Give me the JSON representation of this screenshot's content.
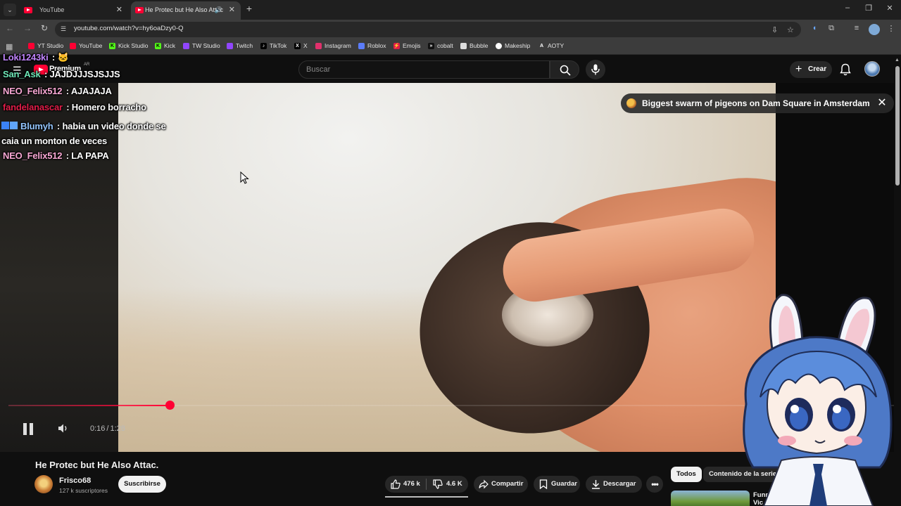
{
  "browser": {
    "tabs": [
      {
        "title": "YouTube",
        "active": false
      },
      {
        "title": "He Protec but He Also Attac",
        "active": true
      }
    ],
    "url": "youtube.com/watch?v=hy6oaDzy0-Q",
    "bookmarks": [
      "YT Studio",
      "YouTube",
      "Kick Studio",
      "Kick",
      "TW Studio",
      "Twitch",
      "TikTok",
      "X",
      "Instagram",
      "Roblox",
      "Emojis",
      "cobalt",
      "Bubble",
      "Makeship",
      "AOTY"
    ]
  },
  "youtube_header": {
    "logo_text": "Premium",
    "region": "AR",
    "search_placeholder": "Buscar",
    "create_label": "Crear"
  },
  "chat": [
    {
      "user": "Loki1243ki",
      "text": "🐱",
      "color": "#c084fc"
    },
    {
      "user": "San_Ask",
      "text": "JAJDJJJSJSJJS",
      "color": "#6ee7b7"
    },
    {
      "user": "NEO_Felix512",
      "text": "AJAJAJA",
      "color": "#f9a8d4"
    },
    {
      "user": "fandelanascar",
      "text": "Homero borracho",
      "color": "#e11d48"
    },
    {
      "user": "Blumyh",
      "text": "habia un video donde se caia un monton de veces",
      "color": "#93c5fd"
    },
    {
      "user": "NEO_Felix512",
      "text": "LA PAPA",
      "color": "#f9a8d4"
    }
  ],
  "notification_chip": "Biggest swarm of pigeons on Dam Square in Amsterdam",
  "player": {
    "current_time": "0:16",
    "duration": "1:28",
    "progress": 0.182,
    "accent_color": "#ff0033"
  },
  "video": {
    "title": "He Protec but He Also Attac.",
    "channel": "Frisco68",
    "subscribers": "127 k suscriptores",
    "subscribe_label": "Suscribirse",
    "likes": "476 k",
    "dislikes": "4.6 K",
    "share_label": "Compartir",
    "save_label": "Guardar",
    "download_label": "Descargar"
  },
  "sidebar": {
    "filters": [
      "Todos",
      "Contenido de la serie",
      "D"
    ],
    "recommendation_title": "Funniest Animal Vic (Part 1)"
  }
}
